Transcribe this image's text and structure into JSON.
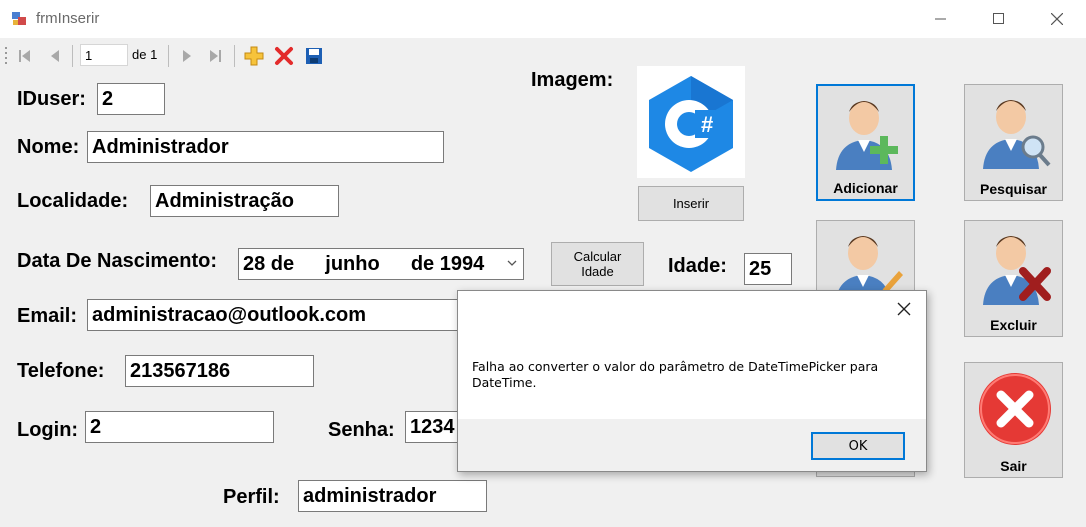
{
  "window": {
    "title": "frmInserir"
  },
  "navigator": {
    "position": "1",
    "count_label": "de 1"
  },
  "form": {
    "iduser_label": "IDuser:",
    "iduser_value": "2",
    "nome_label": "Nome:",
    "nome_value": "Administrador",
    "localidade_label": "Localidade:",
    "localidade_value": "Administração",
    "nascimento_label": "Data De Nascimento:",
    "nascimento_day": "28 de",
    "nascimento_month": "junho",
    "nascimento_year": "de 1994",
    "email_label": "Email:",
    "email_value": "administracao@outlook.com",
    "telefone_label": "Telefone:",
    "telefone_value": "213567186",
    "login_label": "Login:",
    "login_value": "2",
    "senha_label": "Senha:",
    "senha_value": "1234",
    "perfil_label": "Perfil:",
    "perfil_value": "administrador",
    "imagem_label": "Imagem:",
    "idade_label": "Idade:",
    "idade_value": "25",
    "calcular_label_1": "Calcular",
    "calcular_label_2": "Idade",
    "inserir_label": "Inserir"
  },
  "actions": {
    "adicionar": "Adicionar",
    "pesquisar": "Pesquisar",
    "excluir": "Excluir",
    "sair": "Sair"
  },
  "dialog": {
    "message": "Falha ao converter o valor do parâmetro de DateTimePicker para DateTime.",
    "ok_label": "OK"
  },
  "colors": {
    "accent": "#0078d7",
    "csharp_logo": "#1e88e5",
    "delete_red": "#e53935",
    "add_green": "#5cb85c"
  }
}
